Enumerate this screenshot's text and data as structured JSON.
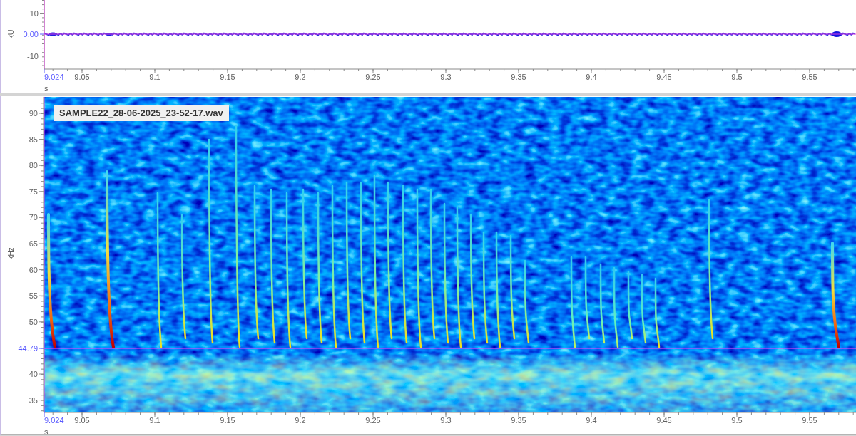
{
  "waveform_panel": {
    "y_axis": {
      "title": "kU",
      "ticks": [
        "10",
        "-10"
      ],
      "cursor_label": "0.00"
    },
    "x_axis": {
      "title": "s",
      "start_label": "9.024",
      "ticks": [
        "9.05",
        "9.1",
        "9.15",
        "9.2",
        "9.25",
        "9.3",
        "9.35",
        "9.4",
        "9.45",
        "9.5",
        "9.55"
      ]
    }
  },
  "spectrogram_panel": {
    "file_label": "SAMPLE22_28-06-2025_23-52-17.wav",
    "y_axis": {
      "title": "kHz",
      "ticks": [
        "90",
        "85",
        "80",
        "75",
        "70",
        "65",
        "60",
        "55",
        "50",
        "40",
        "35"
      ],
      "cursor_label": "44.79"
    },
    "x_axis": {
      "title": "s",
      "start_label": "9.024",
      "ticks": [
        "9.05",
        "9.1",
        "9.15",
        "9.2",
        "9.25",
        "9.3",
        "9.35",
        "9.4",
        "9.45",
        "9.5",
        "9.55"
      ]
    }
  }
}
